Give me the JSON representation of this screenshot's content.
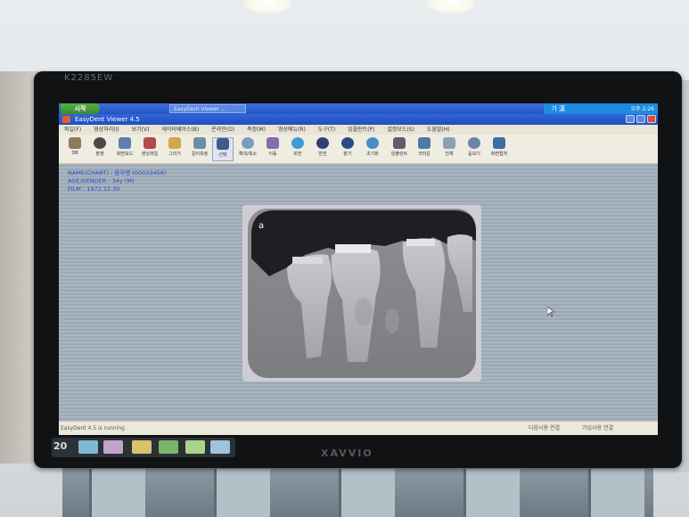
{
  "monitor": {
    "model": "K2285EW",
    "brand": "XAVVIO",
    "osd_value": "20"
  },
  "taskbar": {
    "start_label": "시작",
    "task_item": "EasyDent Viewer ...",
    "ime": "가 漢",
    "clock": "오후 2:26"
  },
  "window": {
    "title": "EasyDent Viewer 4.5"
  },
  "menu": [
    "파일(F)",
    "영상처리(I)",
    "보기(V)",
    "데이터베이스(B)",
    "온라인(O)",
    "측정(M)",
    "영상메뉴(R)",
    "도구(T)",
    "임플란트(P)",
    "설정모드(S)",
    "도움말(H)"
  ],
  "toolbar": [
    "DB",
    "촬영",
    "화면모드",
    "영상파일",
    "그리기",
    "길이측정",
    "선택",
    "확대/축소",
    "이동",
    "회전",
    "반전",
    "밝기",
    "초기화",
    "임플란트",
    "크라운",
    "전체",
    "돋보기",
    "화면캡처"
  ],
  "patient": {
    "line1": "NAME(CHART) : 환자명 (00033456)",
    "line2": "AGE/GENDER : 34y (M)",
    "line3": "FILM : 1972.12.30"
  },
  "status": {
    "left": "EasyDent 4.5 is running",
    "right1": "다음사용 연결",
    "right2": "가입사용 연결"
  },
  "colors": {
    "titlebar": "#2f66d8",
    "taskbar": "#2453c7",
    "start": "#3b8a2e",
    "patient_text": "#2d46c9",
    "viewport": "#a9b6c1"
  }
}
